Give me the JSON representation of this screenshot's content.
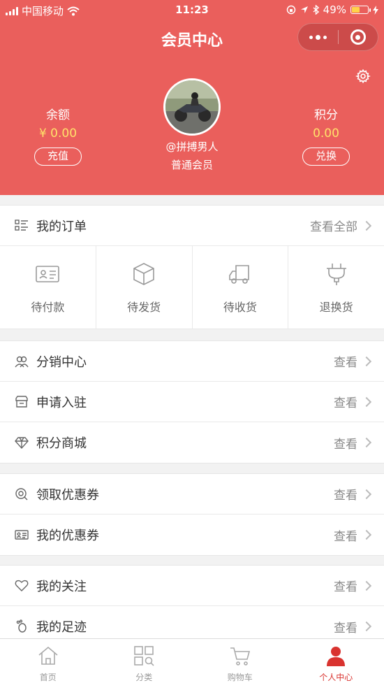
{
  "statusbar": {
    "carrier": "中国移动",
    "time": "11:23",
    "battery": "49%"
  },
  "nav": {
    "title": "会员中心"
  },
  "profile": {
    "username": "@拼搏男人",
    "level": "普通会员",
    "balance": {
      "label": "余额",
      "value": "¥ 0.00",
      "action": "充值"
    },
    "points": {
      "label": "积分",
      "value": "0.00",
      "action": "兑换"
    }
  },
  "orders": {
    "title": "我的订单",
    "view_all": "查看全部",
    "items": [
      {
        "label": "待付款",
        "icon": "card-icon"
      },
      {
        "label": "待发货",
        "icon": "box-icon"
      },
      {
        "label": "待收货",
        "icon": "truck-icon"
      },
      {
        "label": "退换货",
        "icon": "plug-icon"
      }
    ]
  },
  "menu_group1": [
    {
      "label": "分销中心",
      "action": "查看",
      "icon": "users-icon"
    },
    {
      "label": "申请入驻",
      "action": "查看",
      "icon": "store-icon"
    },
    {
      "label": "积分商城",
      "action": "查看",
      "icon": "diamond-icon"
    }
  ],
  "menu_group2": [
    {
      "label": "领取优惠券",
      "action": "查看",
      "icon": "coupon-search-icon"
    },
    {
      "label": "我的优惠券",
      "action": "查看",
      "icon": "coupon-icon"
    }
  ],
  "menu_group3": [
    {
      "label": "我的关注",
      "action": "查看",
      "icon": "heart-icon"
    },
    {
      "label": "我的足迹",
      "action": "查看",
      "icon": "footprint-icon"
    }
  ],
  "tabbar": [
    {
      "label": "首页",
      "icon": "home-icon",
      "active": false
    },
    {
      "label": "分类",
      "icon": "category-icon",
      "active": false
    },
    {
      "label": "购物车",
      "icon": "cart-icon",
      "active": false
    },
    {
      "label": "个人中心",
      "icon": "person-icon",
      "active": true
    }
  ],
  "colors": {
    "brand": "#ea5f5c",
    "accent_value": "#ffe26a",
    "active_tab": "#d9332f"
  }
}
